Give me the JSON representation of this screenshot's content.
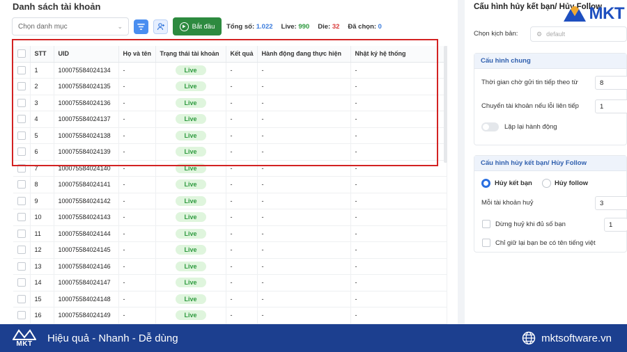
{
  "left_panel": {
    "title": "Danh sách tài khoản",
    "category_placeholder": "Chọn danh mục",
    "start_label": "Bắt đầu",
    "stats": {
      "total_label": "Tổng số:",
      "total_value": "1.022",
      "live_label": "Live:",
      "live_value": "990",
      "die_label": "Die:",
      "die_value": "32",
      "selected_label": "Đã chọn:",
      "selected_value": "0"
    }
  },
  "table": {
    "headers": [
      "STT",
      "UID",
      "Họ và tên",
      "Trạng thái tài khoản",
      "Kết quả",
      "Hành động đang thực hiện",
      "Nhật ký hệ thống"
    ],
    "rows": [
      {
        "stt": "1",
        "uid": "100075584024134",
        "name": "-",
        "status": "Live",
        "result": "-",
        "action": "-",
        "log": "-"
      },
      {
        "stt": "2",
        "uid": "100075584024135",
        "name": "-",
        "status": "Live",
        "result": "-",
        "action": "-",
        "log": "-"
      },
      {
        "stt": "3",
        "uid": "100075584024136",
        "name": "-",
        "status": "Live",
        "result": "-",
        "action": "-",
        "log": "-"
      },
      {
        "stt": "4",
        "uid": "100075584024137",
        "name": "-",
        "status": "Live",
        "result": "-",
        "action": "-",
        "log": "-"
      },
      {
        "stt": "5",
        "uid": "100075584024138",
        "name": "-",
        "status": "Live",
        "result": "-",
        "action": "-",
        "log": "-"
      },
      {
        "stt": "6",
        "uid": "100075584024139",
        "name": "-",
        "status": "Live",
        "result": "-",
        "action": "-",
        "log": "-"
      },
      {
        "stt": "7",
        "uid": "100075584024140",
        "name": "-",
        "status": "Live",
        "result": "-",
        "action": "-",
        "log": "-"
      },
      {
        "stt": "8",
        "uid": "100075584024141",
        "name": "-",
        "status": "Live",
        "result": "-",
        "action": "-",
        "log": "-"
      },
      {
        "stt": "9",
        "uid": "100075584024142",
        "name": "-",
        "status": "Live",
        "result": "-",
        "action": "-",
        "log": "-"
      },
      {
        "stt": "10",
        "uid": "100075584024143",
        "name": "-",
        "status": "Live",
        "result": "-",
        "action": "-",
        "log": "-"
      },
      {
        "stt": "11",
        "uid": "100075584024144",
        "name": "-",
        "status": "Live",
        "result": "-",
        "action": "-",
        "log": "-"
      },
      {
        "stt": "12",
        "uid": "100075584024145",
        "name": "-",
        "status": "Live",
        "result": "-",
        "action": "-",
        "log": "-"
      },
      {
        "stt": "13",
        "uid": "100075584024146",
        "name": "-",
        "status": "Live",
        "result": "-",
        "action": "-",
        "log": "-"
      },
      {
        "stt": "14",
        "uid": "100075584024147",
        "name": "-",
        "status": "Live",
        "result": "-",
        "action": "-",
        "log": "-"
      },
      {
        "stt": "15",
        "uid": "100075584024148",
        "name": "-",
        "status": "Live",
        "result": "-",
        "action": "-",
        "log": "-"
      },
      {
        "stt": "16",
        "uid": "100075584024149",
        "name": "-",
        "status": "Live",
        "result": "-",
        "action": "-",
        "log": "-"
      }
    ]
  },
  "config": {
    "title": "Cấu hình hủy kết bạn/ Hủy Follow",
    "script_label": "Chọn kịch bản:",
    "script_placeholder": "default",
    "general": {
      "header": "Cấu hình chung",
      "wait_label": "Thời gian chờ gửi tin tiếp theo từ",
      "wait_value": "8",
      "switch_label": "Chuyển tài khoản nếu lỗi liên tiếp",
      "switch_value": "1",
      "repeat_label": "Lặp lại hành động"
    },
    "unfriend": {
      "header": "Cấu hình hủy kết bạn/ Hủy Follow",
      "radio_unfriend": "Hủy kết bạn",
      "radio_unfollow": "Hủy follow",
      "per_account_label": "Mỗi tài khoản huỷ",
      "per_account_value": "3",
      "stop_label": "Dừng huỷ khi đủ số bạn",
      "stop_value": "1",
      "keep_vn_label": "Chỉ giữ lại bạn be có tên tiếng việt"
    }
  },
  "logo": {
    "text": "MKT"
  },
  "footer": {
    "brand": "MKT",
    "slogan": "Hiệu quả - Nhanh - Dễ dùng",
    "website": "mktsoftware.vn"
  },
  "colors": {
    "accent_blue": "#4a8ef0",
    "start_green": "#2d8a3f",
    "live_green": "#2e9a3f",
    "die_red": "#d93a3a",
    "highlight_red": "#d32222",
    "footer_bg": "#1c3f8f"
  }
}
